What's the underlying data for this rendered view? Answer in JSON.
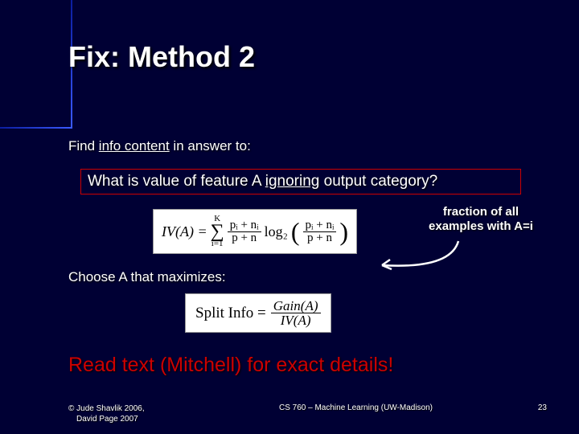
{
  "title": "Fix: Method 2",
  "intro": {
    "pre": "Find ",
    "underlined": "info content",
    "post": " in answer to:"
  },
  "question": {
    "pre": "What is value of feature A ",
    "underlined": "ignoring",
    "post": " output category?"
  },
  "formula_iv": {
    "lhs": "IV(A) =",
    "sum_top": "K",
    "sum_bottom": "i=1",
    "frac1_num": "pᵢ + nᵢ",
    "frac1_den": "p + n",
    "log": "log₂",
    "frac2_num": "pᵢ + nᵢ",
    "frac2_den": "p + n"
  },
  "annotation": "fraction of all examples with A=i",
  "choose_line": "Choose A that maximizes:",
  "formula_split": {
    "lhs": "Split Info =",
    "num": "Gain(A)",
    "den": "IV(A)"
  },
  "read_line": "Read text (Mitchell) for exact details!",
  "footer": {
    "copyright_l1": "© Jude Shavlik 2006,",
    "copyright_l2": "David Page 2007",
    "course": "CS 760 – Machine Learning (UW-Madison)",
    "page": "23"
  }
}
